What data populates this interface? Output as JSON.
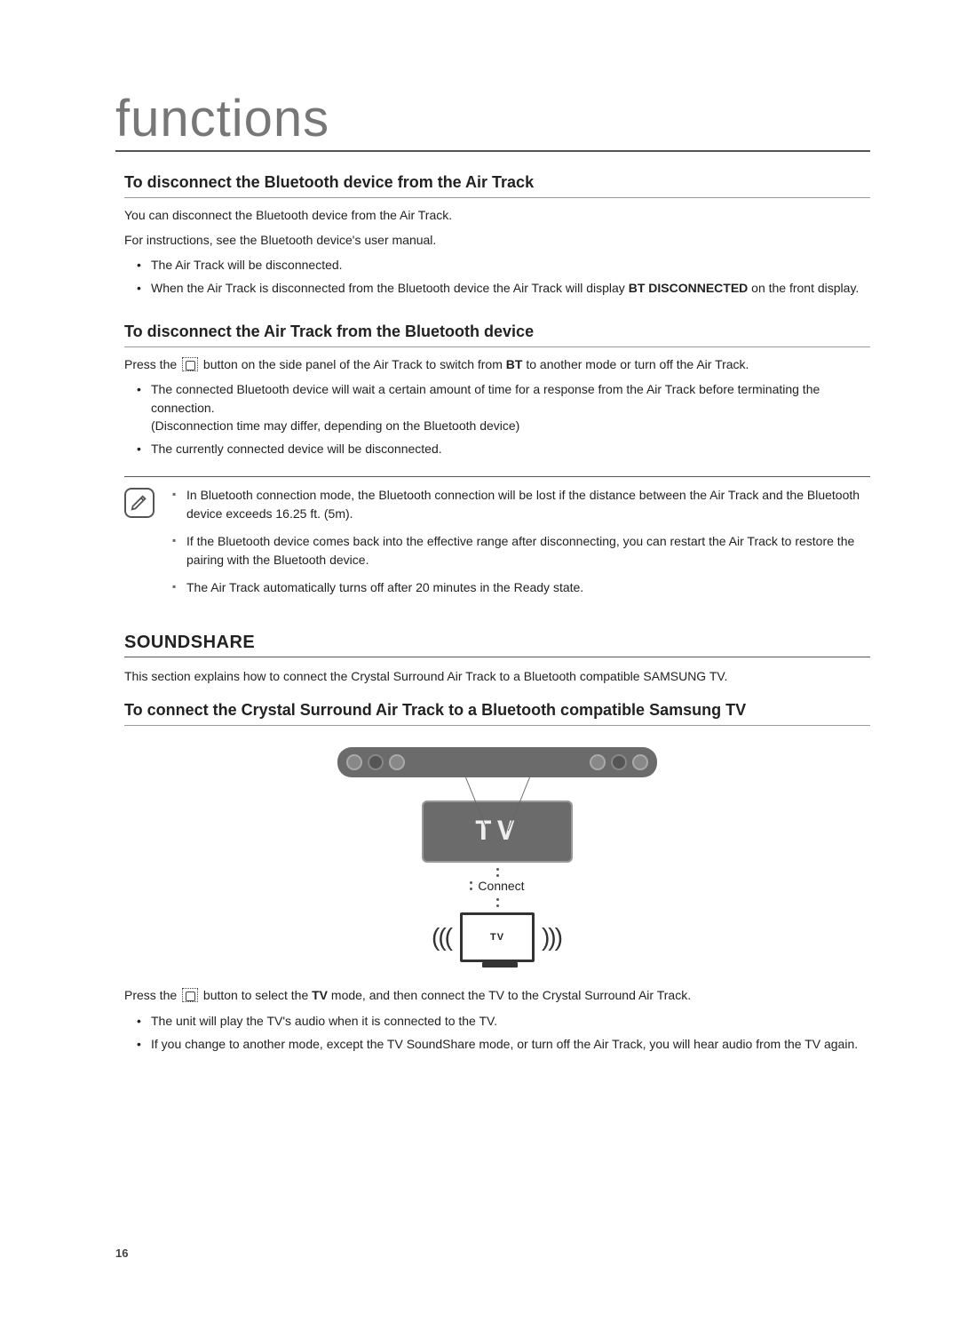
{
  "page": {
    "title": "functions",
    "number": "16"
  },
  "section1": {
    "heading": "To disconnect the Bluetooth device from the Air Track",
    "intro1": "You can disconnect the Bluetooth device from the Air Track.",
    "intro2": "For instructions, see the Bluetooth device's user manual.",
    "bullets": {
      "b1": "The Air Track will be disconnected.",
      "b2_pre": "When the Air Track is disconnected from the Bluetooth device the Air Track will display ",
      "b2_bold": "BT DISCONNECTED",
      "b2_post": " on the front display."
    }
  },
  "section2": {
    "heading": "To disconnect the Air Track from the Bluetooth device",
    "intro_pre": "Press the ",
    "intro_mid": " button on the side panel of the Air Track to switch from ",
    "intro_bold": "BT",
    "intro_post": " to another mode or turn off the Air Track.",
    "bullets": {
      "b1_line1": "The connected Bluetooth device will wait a certain amount of time for a response from the Air Track before terminating the connection.",
      "b1_line2": "(Disconnection time may differ, depending on the Bluetooth device)",
      "b2": "The currently connected device will be disconnected."
    },
    "notes": {
      "n1": "In Bluetooth connection mode, the Bluetooth connection will be lost if the distance between the Air Track and the Bluetooth device exceeds 16.25 ft. (5m).",
      "n2": "If the Bluetooth device comes back into the effective range after disconnecting, you can restart the Air Track to restore the pairing with the Bluetooth device.",
      "n3": "The Air Track automatically turns off after 20 minutes in the Ready state."
    }
  },
  "soundshare": {
    "heading": "SOUNDSHARE",
    "intro": "This section explains how to connect the Crystal Surround Air Track to a Bluetooth compatible SAMSUNG TV.",
    "sub_heading": "To connect the Crystal Surround Air Track to a Bluetooth compatible Samsung TV",
    "diagram": {
      "display_text": "TV",
      "connect_label": "Connect",
      "tv_label": "TV"
    },
    "press_pre": "Press the ",
    "press_mid": " button to select the ",
    "press_bold": "TV",
    "press_post": " mode, and then connect the TV to the Crystal Surround Air Track.",
    "bullets": {
      "b1": "The unit will play the TV's audio when it is connected to the TV.",
      "b2": "If you change to another mode, except the TV SoundShare mode, or turn off the Air Track, you will hear audio from the TV again."
    }
  }
}
